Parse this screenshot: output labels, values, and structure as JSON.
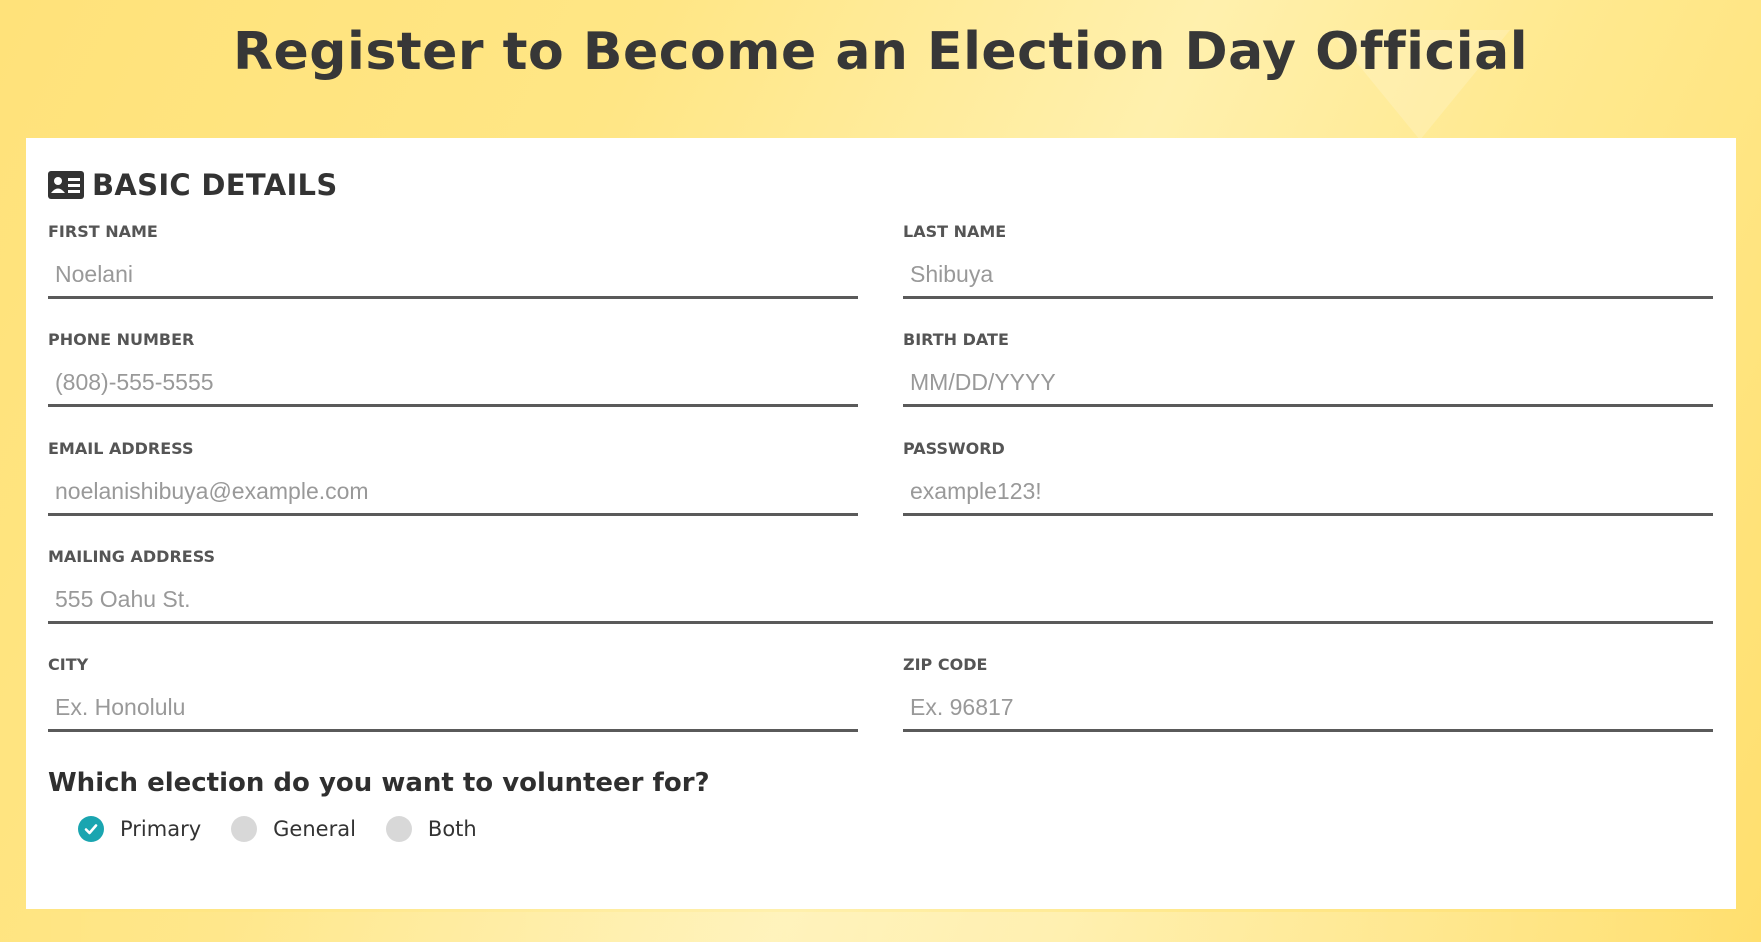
{
  "page": {
    "title": "Register to Become an Election Day Official"
  },
  "section": {
    "title": "BASIC DETAILS",
    "icon": "id-card-icon"
  },
  "fields": {
    "first_name": {
      "label": "FIRST NAME",
      "value": "",
      "placeholder": "Noelani"
    },
    "last_name": {
      "label": "LAST NAME",
      "value": "",
      "placeholder": "Shibuya"
    },
    "phone": {
      "label": "PHONE NUMBER",
      "value": "",
      "placeholder": "(808)-555-5555"
    },
    "birth_date": {
      "label": "BIRTH DATE",
      "value": "",
      "placeholder": "MM/DD/YYYY"
    },
    "email": {
      "label": "EMAIL ADDRESS",
      "value": "",
      "placeholder": "noelanishibuya@example.com"
    },
    "password": {
      "label": "PASSWORD",
      "value": "",
      "placeholder": "example123!"
    },
    "mailing_address": {
      "label": "MAILING ADDRESS",
      "value": "",
      "placeholder": "555 Oahu St."
    },
    "city": {
      "label": "CITY",
      "value": "",
      "placeholder": "Ex. Honolulu"
    },
    "zip": {
      "label": "ZIP CODE",
      "value": "",
      "placeholder": "Ex. 96817"
    }
  },
  "election": {
    "question": "Which election do you want to volunteer for?",
    "options": [
      {
        "label": "Primary",
        "selected": true
      },
      {
        "label": "General",
        "selected": false
      },
      {
        "label": "Both",
        "selected": false
      }
    ]
  },
  "colors": {
    "accent": "#1aa5b0",
    "background": "#ffe27a",
    "text_dark": "#333333"
  }
}
